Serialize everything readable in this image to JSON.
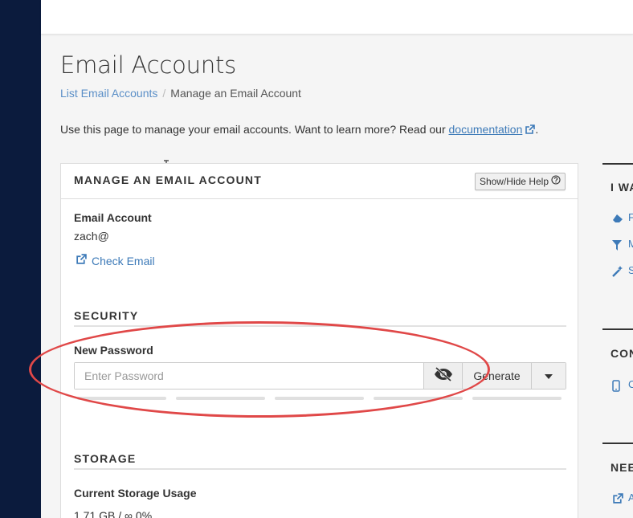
{
  "page": {
    "title": "Email Accounts",
    "breadcrumb": {
      "parent": "List Email Accounts",
      "current": "Manage an Email Account"
    },
    "intro": "Use this page to manage your email accounts. Want to learn more? Read our ",
    "intro_link": "documentation",
    "intro_end": "."
  },
  "panel": {
    "title": "MANAGE AN EMAIL ACCOUNT",
    "help_button": "Show/Hide Help",
    "email_label": "Email Account",
    "email_value": "zach@",
    "check_email": "Check Email",
    "security_title": "SECURITY",
    "new_password_label": "New Password",
    "password_placeholder": "Enter Password",
    "generate_button": "Generate",
    "storage_title": "STORAGE",
    "storage_usage_label": "Current Storage Usage",
    "storage_usage_value": "1.71 GB / ∞ 0%"
  },
  "right": {
    "section1_head": "I WA",
    "section1_items": [
      "F",
      "M",
      "S"
    ],
    "section2_head": "CON",
    "section2_items": [
      "C"
    ],
    "section3_head": "NEE",
    "section3_items": [
      "A"
    ]
  },
  "colors": {
    "sidebar": "#0b1b3d",
    "link": "#3d7ab8",
    "annotation": "#e04848"
  }
}
